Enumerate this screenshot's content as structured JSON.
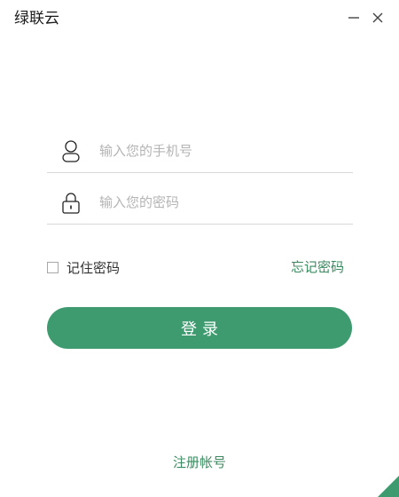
{
  "window": {
    "title": "绿联云"
  },
  "login": {
    "phone_placeholder": "输入您的手机号",
    "password_placeholder": "输入您的密码",
    "remember_label": "记住密码",
    "forgot_label": "忘记密码",
    "submit_label": "登录"
  },
  "footer": {
    "register_label": "注册帐号"
  },
  "icons": {
    "minimize": "minimize-icon",
    "close": "close-icon",
    "user": "user-icon",
    "lock": "lock-icon"
  },
  "colors": {
    "accent": "#3d9b6f",
    "link": "#3a8a5f",
    "placeholder": "#b4b4b4"
  }
}
